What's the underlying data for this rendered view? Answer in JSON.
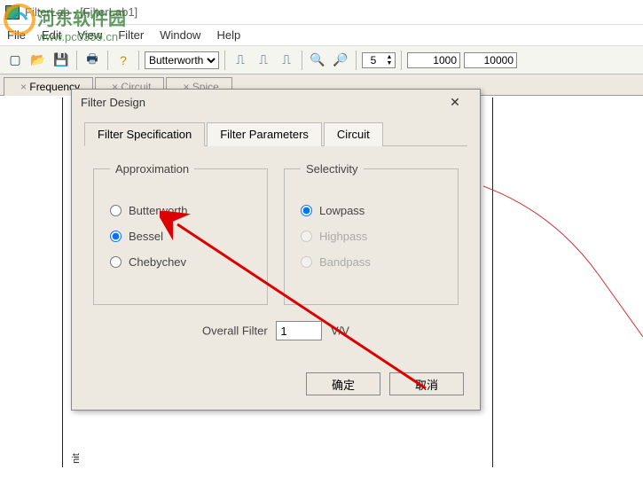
{
  "window": {
    "title": "FilterLab - [FilterLab1]"
  },
  "menu": {
    "file": "File",
    "edit": "Edit",
    "view": "View",
    "filter": "Filter",
    "window": "Window",
    "help": "Help"
  },
  "toolbar": {
    "approx_selected": "Butterworth",
    "spin_value": "5",
    "field1": "1000",
    "field2": "10000"
  },
  "doc_tabs": {
    "t1": "Frequency",
    "t2": "Circuit",
    "t3": "Spice"
  },
  "dialog": {
    "title": "Filter Design",
    "tabs": {
      "spec": "Filter Specification",
      "params": "Filter Parameters",
      "circuit": "Circuit"
    },
    "approx": {
      "legend": "Approximation",
      "butterworth": "Butterworth",
      "bessel": "Bessel",
      "chebychev": "Chebychev",
      "selected": "bessel"
    },
    "selectivity": {
      "legend": "Selectivity",
      "lowpass": "Lowpass",
      "highpass": "Highpass",
      "bandpass": "Bandpass",
      "selected": "lowpass"
    },
    "overall": {
      "label": "Overall Filter",
      "value": "1",
      "unit": "V/V"
    },
    "buttons": {
      "ok": "确定",
      "cancel": "取消"
    }
  },
  "watermark": {
    "text1": "河东软件园",
    "text2": "www.pc0359.cn"
  }
}
